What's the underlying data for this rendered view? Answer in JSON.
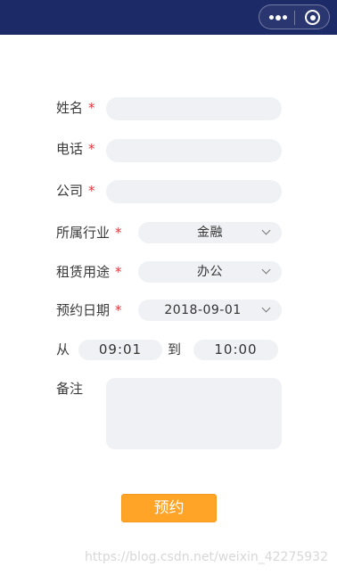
{
  "form": {
    "name": {
      "label": "姓名",
      "required_mark": "*",
      "value": ""
    },
    "phone": {
      "label": "电话",
      "required_mark": "*",
      "value": ""
    },
    "company": {
      "label": "公司",
      "required_mark": "*",
      "value": ""
    },
    "industry": {
      "label": "所属行业",
      "required_mark": "*",
      "value": "金融"
    },
    "purpose": {
      "label": "租赁用途",
      "required_mark": "*",
      "value": "办公"
    },
    "date": {
      "label": "预约日期",
      "required_mark": "*",
      "value": "2018-09-01"
    },
    "time": {
      "from_label": "从",
      "start": "09:01",
      "to_label": "到",
      "end": "10:00"
    },
    "remark": {
      "label": "备注",
      "value": ""
    },
    "submit_label": "预约"
  },
  "watermark": "https://blog.csdn.net/weixin_42275932",
  "colors": {
    "nav_bar": "#1d2a68",
    "required": "#e0353c",
    "submit": "#ffa426",
    "field_bg": "#f0f1f4"
  },
  "icons": [
    "more-dots-icon",
    "close-target-icon",
    "chevron-down-icon"
  ]
}
